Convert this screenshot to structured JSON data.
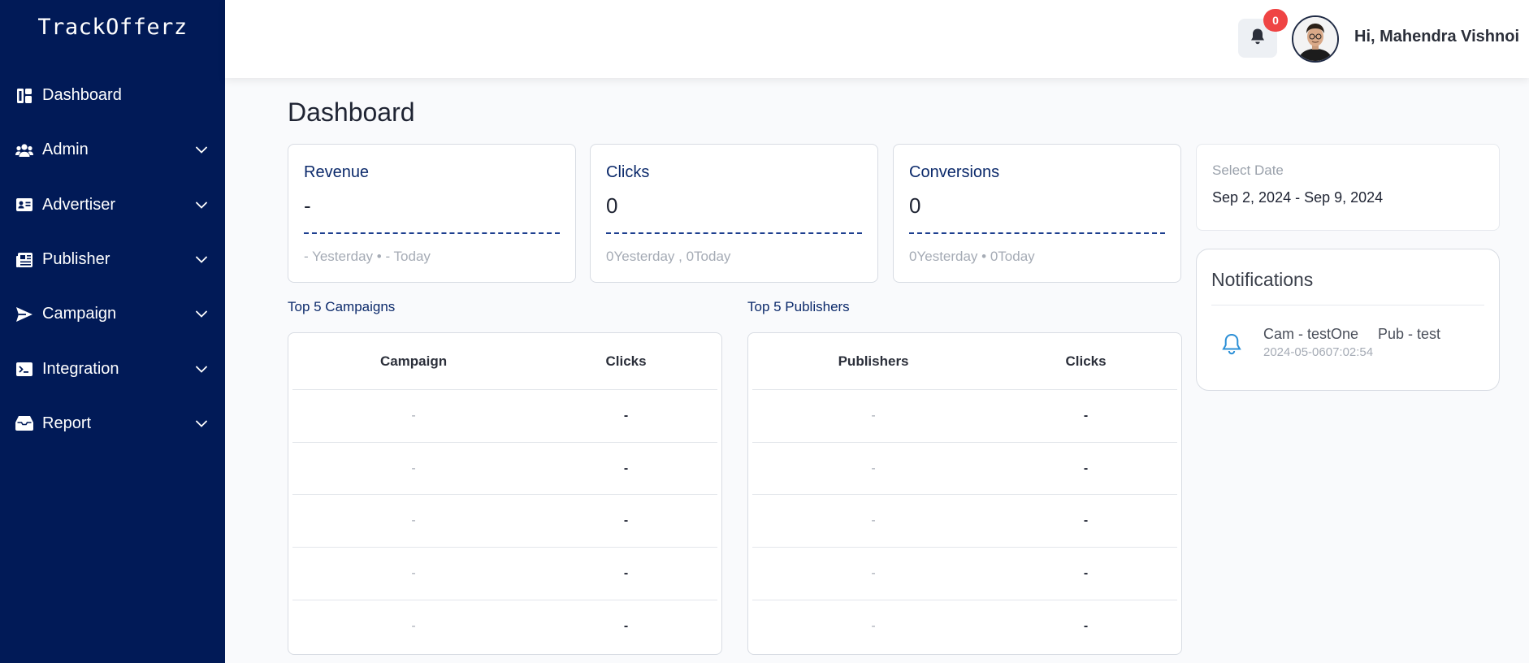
{
  "sidebar": {
    "brand": "TrackOfferz",
    "items": [
      {
        "label": "Dashboard",
        "icon": "dashboard-icon",
        "has_chevron": false
      },
      {
        "label": "Admin",
        "icon": "users-icon",
        "has_chevron": true
      },
      {
        "label": "Advertiser",
        "icon": "id-card-icon",
        "has_chevron": true
      },
      {
        "label": "Publisher",
        "icon": "newspaper-icon",
        "has_chevron": true
      },
      {
        "label": "Campaign",
        "icon": "paper-plane-icon",
        "has_chevron": true
      },
      {
        "label": "Integration",
        "icon": "terminal-icon",
        "has_chevron": true
      },
      {
        "label": "Report",
        "icon": "inbox-icon",
        "has_chevron": true
      }
    ]
  },
  "topbar": {
    "notification_count": "0",
    "greeting": "Hi, Mahendra Vishnoi"
  },
  "page": {
    "title": "Dashboard"
  },
  "stats": [
    {
      "title": "Revenue",
      "value": "-",
      "footer": "- Yesterday • - Today"
    },
    {
      "title": "Clicks",
      "value": "0",
      "footer": "0Yesterday , 0Today"
    },
    {
      "title": "Conversions",
      "value": "0",
      "footer": "0Yesterday • 0Today"
    }
  ],
  "date_picker": {
    "label": "Select Date",
    "value": "Sep 2, 2024 - Sep 9, 2024"
  },
  "notifications": {
    "title": "Notifications",
    "items": [
      {
        "campaign": "Cam - testOne",
        "publisher": "Pub - test",
        "time": "2024-05-0607:02:54"
      }
    ]
  },
  "top_campaigns": {
    "label": "Top 5 Campaigns",
    "headers": [
      "Campaign",
      "Clicks"
    ],
    "rows": [
      [
        "-",
        "-"
      ],
      [
        "-",
        "-"
      ],
      [
        "-",
        "-"
      ],
      [
        "-",
        "-"
      ],
      [
        "-",
        "-"
      ]
    ]
  },
  "top_publishers": {
    "label": "Top 5 Publishers",
    "headers": [
      "Publishers",
      "Clicks"
    ],
    "rows": [
      [
        "-",
        "-"
      ],
      [
        "-",
        "-"
      ],
      [
        "-",
        "-"
      ],
      [
        "-",
        "-"
      ],
      [
        "-",
        "-"
      ]
    ]
  },
  "colors": {
    "sidebar_bg": "#011a57",
    "accent": "#0c2a6b",
    "badge": "#ef4444",
    "notification_icon": "#2b8fd6"
  }
}
